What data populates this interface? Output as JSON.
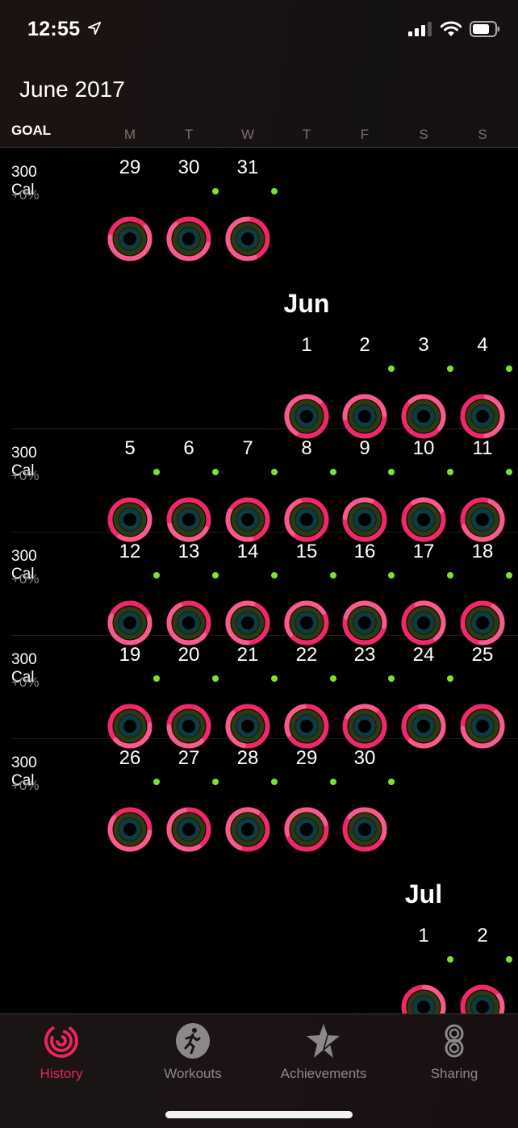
{
  "status_bar": {
    "time": "12:55",
    "location_icon": "location-arrow-icon",
    "signal_icon": "cellular-signal-icon",
    "wifi_icon": "wifi-icon",
    "battery_icon": "battery-icon"
  },
  "header": {
    "title": "June 2017",
    "goal_label": "GOAL",
    "weekdays": [
      "M",
      "T",
      "W",
      "T",
      "F",
      "S",
      "S"
    ]
  },
  "colors": {
    "move_ring": "#f0286a",
    "move_ring_light": "#f85a8a",
    "exercise_ring_track": "#2c3a12",
    "stand_ring_track": "#0f3a40",
    "goal_dot": "#7fe32e",
    "accent": "#e8265a"
  },
  "months": {
    "jun": "Jun",
    "jul": "Jul"
  },
  "weeks": [
    {
      "goal": "300 Cal",
      "change": "+0%",
      "days": [
        {
          "col": 0,
          "day": "29",
          "dot": false
        },
        {
          "col": 1,
          "day": "30",
          "dot": true
        },
        {
          "col": 2,
          "day": "31",
          "dot": true
        }
      ]
    },
    {
      "goal": "",
      "change": "",
      "days": [
        {
          "col": 3,
          "day": "1",
          "dot": false
        },
        {
          "col": 4,
          "day": "2",
          "dot": true
        },
        {
          "col": 5,
          "day": "3",
          "dot": true
        },
        {
          "col": 6,
          "day": "4",
          "dot": true
        }
      ]
    },
    {
      "goal": "300 Cal",
      "change": "+0%",
      "days": [
        {
          "col": 0,
          "day": "5",
          "dot": true
        },
        {
          "col": 1,
          "day": "6",
          "dot": true
        },
        {
          "col": 2,
          "day": "7",
          "dot": true
        },
        {
          "col": 3,
          "day": "8",
          "dot": true
        },
        {
          "col": 4,
          "day": "9",
          "dot": true
        },
        {
          "col": 5,
          "day": "10",
          "dot": true
        },
        {
          "col": 6,
          "day": "11",
          "dot": true
        }
      ]
    },
    {
      "goal": "300 Cal",
      "change": "+0%",
      "days": [
        {
          "col": 0,
          "day": "12",
          "dot": true
        },
        {
          "col": 1,
          "day": "13",
          "dot": true
        },
        {
          "col": 2,
          "day": "14",
          "dot": true
        },
        {
          "col": 3,
          "day": "15",
          "dot": true
        },
        {
          "col": 4,
          "day": "16",
          "dot": true
        },
        {
          "col": 5,
          "day": "17",
          "dot": true
        },
        {
          "col": 6,
          "day": "18",
          "dot": true
        }
      ]
    },
    {
      "goal": "300 Cal",
      "change": "+0%",
      "days": [
        {
          "col": 0,
          "day": "19",
          "dot": true
        },
        {
          "col": 1,
          "day": "20",
          "dot": true
        },
        {
          "col": 2,
          "day": "21",
          "dot": true
        },
        {
          "col": 3,
          "day": "22",
          "dot": true
        },
        {
          "col": 4,
          "day": "23",
          "dot": true
        },
        {
          "col": 5,
          "day": "24",
          "dot": true
        },
        {
          "col": 6,
          "day": "25",
          "dot": false
        }
      ]
    },
    {
      "goal": "300 Cal",
      "change": "+0%",
      "days": [
        {
          "col": 0,
          "day": "26",
          "dot": true
        },
        {
          "col": 1,
          "day": "27",
          "dot": true
        },
        {
          "col": 2,
          "day": "28",
          "dot": true
        },
        {
          "col": 3,
          "day": "29",
          "dot": true
        },
        {
          "col": 4,
          "day": "30",
          "dot": true
        }
      ]
    },
    {
      "goal": "",
      "change": "",
      "days": [
        {
          "col": 5,
          "day": "1",
          "dot": true
        },
        {
          "col": 6,
          "day": "2",
          "dot": true
        }
      ]
    }
  ],
  "tabs": [
    {
      "label": "History",
      "icon": "history-rings-icon",
      "active": true
    },
    {
      "label": "Workouts",
      "icon": "workout-runner-icon",
      "active": false
    },
    {
      "label": "Achievements",
      "icon": "achievement-star-icon",
      "active": false
    },
    {
      "label": "Sharing",
      "icon": "sharing-icon",
      "active": false
    }
  ]
}
